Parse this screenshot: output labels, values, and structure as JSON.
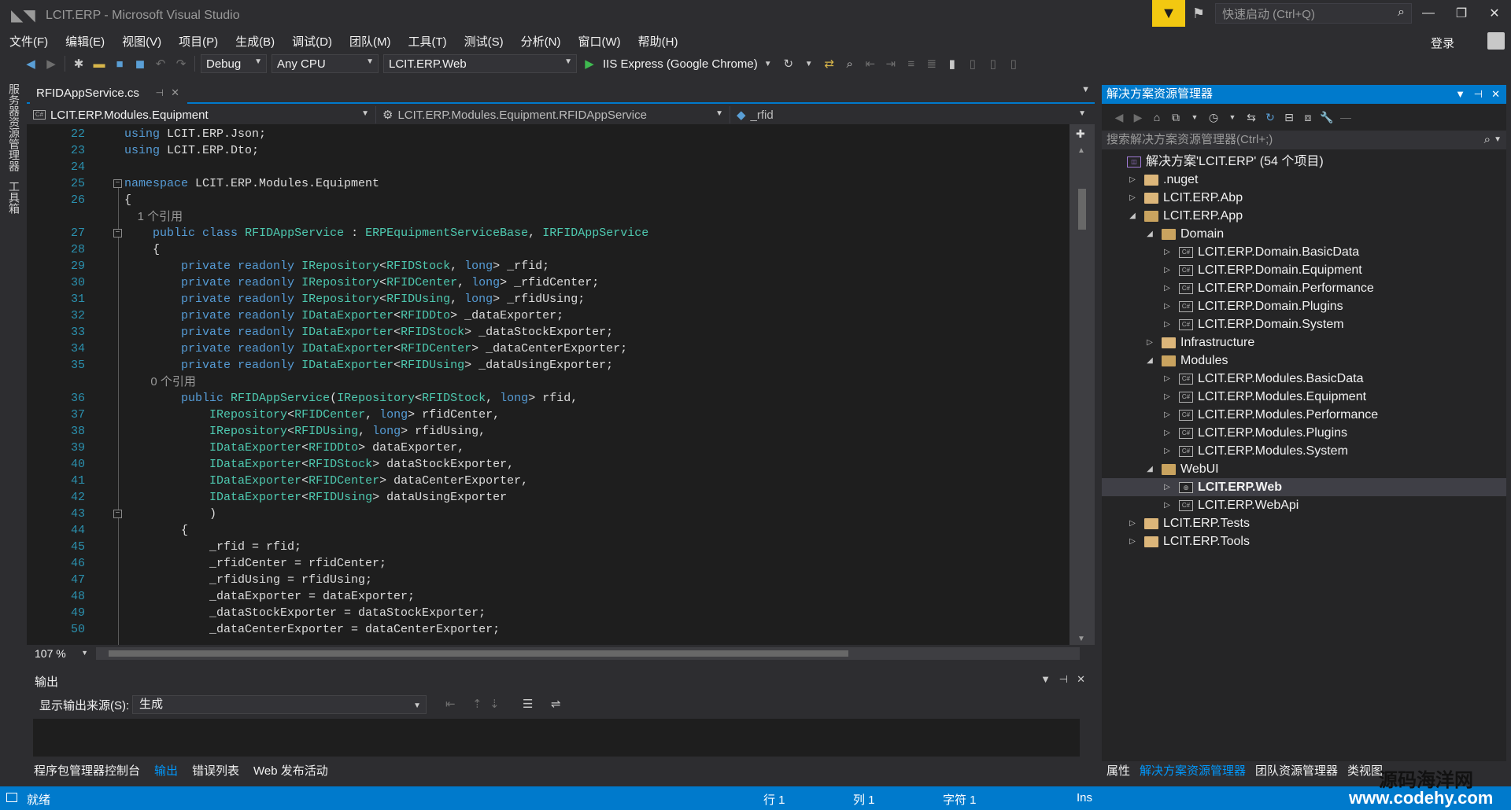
{
  "window": {
    "title": "LCIT.ERP - Microsoft Visual Studio",
    "quick_launch_placeholder": "快速启动 (Ctrl+Q)",
    "login_label": "登录"
  },
  "menu": [
    "文件(F)",
    "编辑(E)",
    "视图(V)",
    "项目(P)",
    "生成(B)",
    "调试(D)",
    "团队(M)",
    "工具(T)",
    "测试(S)",
    "分析(N)",
    "窗口(W)",
    "帮助(H)"
  ],
  "toolbar": {
    "configuration": "Debug",
    "platform": "Any CPU",
    "startup_project": "LCIT.ERP.Web",
    "run_target": "IIS Express (Google Chrome)"
  },
  "left_strip": {
    "server_explorer": "服务器资源管理器",
    "toolbox": "工具箱"
  },
  "doc_tab": {
    "filename": "RFIDAppService.cs"
  },
  "navbar": {
    "project": "LCIT.ERP.Modules.Equipment",
    "class": "LCIT.ERP.Modules.Equipment.RFIDAppService",
    "member": "_rfid"
  },
  "code": {
    "lines": [
      {
        "n": "22",
        "t": "using LCIT.ERP.Json;"
      },
      {
        "n": "23",
        "t": "using LCIT.ERP.Dto;"
      },
      {
        "n": "24",
        "t": ""
      },
      {
        "n": "25",
        "t": "namespace LCIT.ERP.Modules.Equipment"
      },
      {
        "n": "26",
        "t": "{"
      },
      {
        "n": "",
        "t": "    1 个引用",
        "ref": true
      },
      {
        "n": "27",
        "t": "    public class RFIDAppService : ERPEquipmentServiceBase, IRFIDAppService"
      },
      {
        "n": "28",
        "t": "    {"
      },
      {
        "n": "29",
        "t": "        private readonly IRepository<RFIDStock, long> _rfid;"
      },
      {
        "n": "30",
        "t": "        private readonly IRepository<RFIDCenter, long> _rfidCenter;"
      },
      {
        "n": "31",
        "t": "        private readonly IRepository<RFIDUsing, long> _rfidUsing;"
      },
      {
        "n": "32",
        "t": "        private readonly IDataExporter<RFIDDto> _dataExporter;"
      },
      {
        "n": "33",
        "t": "        private readonly IDataExporter<RFIDStock> _dataStockExporter;"
      },
      {
        "n": "34",
        "t": "        private readonly IDataExporter<RFIDCenter> _dataCenterExporter;"
      },
      {
        "n": "35",
        "t": "        private readonly IDataExporter<RFIDUsing> _dataUsingExporter;"
      },
      {
        "n": "",
        "t": "        0 个引用",
        "ref": true
      },
      {
        "n": "36",
        "t": "        public RFIDAppService(IRepository<RFIDStock, long> rfid,"
      },
      {
        "n": "37",
        "t": "            IRepository<RFIDCenter, long> rfidCenter,"
      },
      {
        "n": "38",
        "t": "            IRepository<RFIDUsing, long> rfidUsing,"
      },
      {
        "n": "39",
        "t": "            IDataExporter<RFIDDto> dataExporter,"
      },
      {
        "n": "40",
        "t": "            IDataExporter<RFIDStock> dataStockExporter,"
      },
      {
        "n": "41",
        "t": "            IDataExporter<RFIDCenter> dataCenterExporter,"
      },
      {
        "n": "42",
        "t": "            IDataExporter<RFIDUsing> dataUsingExporter"
      },
      {
        "n": "43",
        "t": "            )"
      },
      {
        "n": "44",
        "t": "        {"
      },
      {
        "n": "45",
        "t": "            _rfid = rfid;"
      },
      {
        "n": "46",
        "t": "            _rfidCenter = rfidCenter;"
      },
      {
        "n": "47",
        "t": "            _rfidUsing = rfidUsing;"
      },
      {
        "n": "48",
        "t": "            _dataExporter = dataExporter;"
      },
      {
        "n": "49",
        "t": "            _dataStockExporter = dataStockExporter;"
      },
      {
        "n": "50",
        "t": "            _dataCenterExporter = dataCenterExporter;"
      }
    ]
  },
  "zoom": "107 %",
  "output": {
    "title": "输出",
    "source_label": "显示输出来源(S):",
    "source_value": "生成"
  },
  "bottom_tabs": [
    "程序包管理器控制台",
    "输出",
    "错误列表",
    "Web 发布活动"
  ],
  "solution_explorer": {
    "title": "解决方案资源管理器",
    "search_placeholder": "搜索解决方案资源管理器(Ctrl+;)",
    "tree": [
      {
        "label": "解决方案'LCIT.ERP' (54 个项目)",
        "level": 0,
        "icon": "sln",
        "exp": ""
      },
      {
        "label": ".nuget",
        "level": 1,
        "icon": "folder",
        "exp": "▷"
      },
      {
        "label": "LCIT.ERP.Abp",
        "level": 1,
        "icon": "folder",
        "exp": "▷"
      },
      {
        "label": "LCIT.ERP.App",
        "level": 1,
        "icon": "folder-open",
        "exp": "◢"
      },
      {
        "label": "Domain",
        "level": 2,
        "icon": "folder-open",
        "exp": "◢"
      },
      {
        "label": "LCIT.ERP.Domain.BasicData",
        "level": 3,
        "icon": "csproj",
        "exp": "▷"
      },
      {
        "label": "LCIT.ERP.Domain.Equipment",
        "level": 3,
        "icon": "csproj",
        "exp": "▷"
      },
      {
        "label": "LCIT.ERP.Domain.Performance",
        "level": 3,
        "icon": "csproj",
        "exp": "▷"
      },
      {
        "label": "LCIT.ERP.Domain.Plugins",
        "level": 3,
        "icon": "csproj",
        "exp": "▷"
      },
      {
        "label": "LCIT.ERP.Domain.System",
        "level": 3,
        "icon": "csproj",
        "exp": "▷"
      },
      {
        "label": "Infrastructure",
        "level": 2,
        "icon": "folder",
        "exp": "▷"
      },
      {
        "label": "Modules",
        "level": 2,
        "icon": "folder-open",
        "exp": "◢"
      },
      {
        "label": "LCIT.ERP.Modules.BasicData",
        "level": 3,
        "icon": "csproj",
        "exp": "▷"
      },
      {
        "label": "LCIT.ERP.Modules.Equipment",
        "level": 3,
        "icon": "csproj",
        "exp": "▷"
      },
      {
        "label": "LCIT.ERP.Modules.Performance",
        "level": 3,
        "icon": "csproj",
        "exp": "▷"
      },
      {
        "label": "LCIT.ERP.Modules.Plugins",
        "level": 3,
        "icon": "csproj",
        "exp": "▷"
      },
      {
        "label": "LCIT.ERP.Modules.System",
        "level": 3,
        "icon": "csproj",
        "exp": "▷"
      },
      {
        "label": "WebUI",
        "level": 2,
        "icon": "folder-open",
        "exp": "◢"
      },
      {
        "label": "LCIT.ERP.Web",
        "level": 3,
        "icon": "web",
        "exp": "▷",
        "selected": true
      },
      {
        "label": "LCIT.ERP.WebApi",
        "level": 3,
        "icon": "csproj",
        "exp": "▷"
      },
      {
        "label": "LCIT.ERP.Tests",
        "level": 1,
        "icon": "folder",
        "exp": "▷"
      },
      {
        "label": "LCIT.ERP.Tools",
        "level": 1,
        "icon": "folder",
        "exp": "▷"
      }
    ]
  },
  "se_tabs": [
    "属性",
    "解决方案资源管理器",
    "团队资源管理器",
    "类视图"
  ],
  "status": {
    "ready": "就绪",
    "line": "行 1",
    "col": "列 1",
    "char": "字符 1",
    "mode": "Ins",
    "watermark_cn": "源码海洋网",
    "watermark_url": "www.codehy.com"
  },
  "colors": {
    "accent": "#007acc",
    "filter": "#f2c811",
    "keyword": "#569cd6",
    "type": "#4ec9b0",
    "line_number": "#2b91af"
  }
}
